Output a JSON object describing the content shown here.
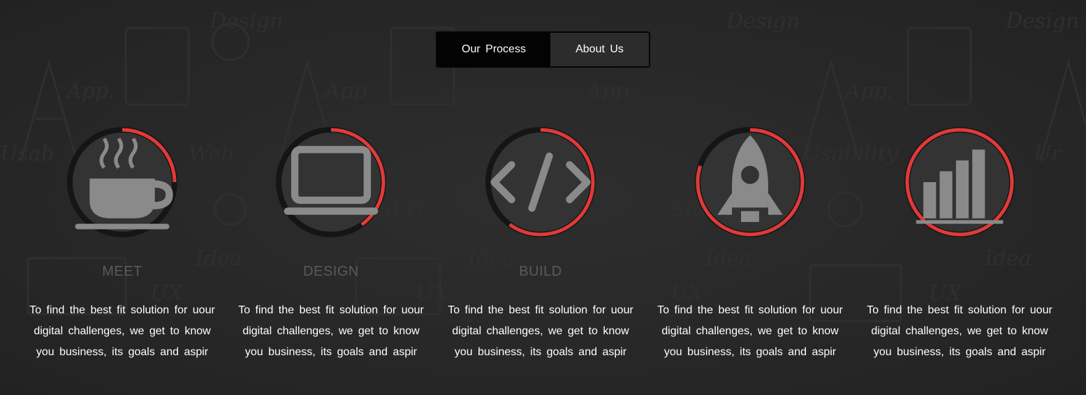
{
  "tabs": [
    {
      "label": "Our Process",
      "active": true
    },
    {
      "label": "About Us",
      "active": false
    }
  ],
  "colors": {
    "accent": "#e03a3a",
    "ring_track": "#151515",
    "inner_disc": "#333333",
    "icon": "#8a8a8a",
    "title": "#5a5a5a",
    "text": "#ffffff"
  },
  "steps": [
    {
      "title": "MEET",
      "icon": "coffee-cup-icon",
      "progress": 0.25,
      "text": "To find the best fit solution for uour digital challenges, we get to know you business, its goals and aspir"
    },
    {
      "title": "DESIGN",
      "icon": "laptop-icon",
      "progress": 0.4,
      "text": "To find the best fit solution for uour digital challenges, we get to know you business, its goals and aspir"
    },
    {
      "title": "BUILD",
      "icon": "code-icon",
      "progress": 0.6,
      "text": "To find the best fit solution for uour digital challenges, we get to know you business, its goals and aspir"
    },
    {
      "title": "",
      "icon": "rocket-icon",
      "progress": 0.8,
      "text": "To find the best fit solution for uour digital challenges, we get to know you business, its goals and aspir"
    },
    {
      "title": "",
      "icon": "bar-chart-icon",
      "progress": 1.0,
      "text": "To find the best fit solution for uour digital challenges, we get to know you business, its goals and aspir"
    }
  ]
}
